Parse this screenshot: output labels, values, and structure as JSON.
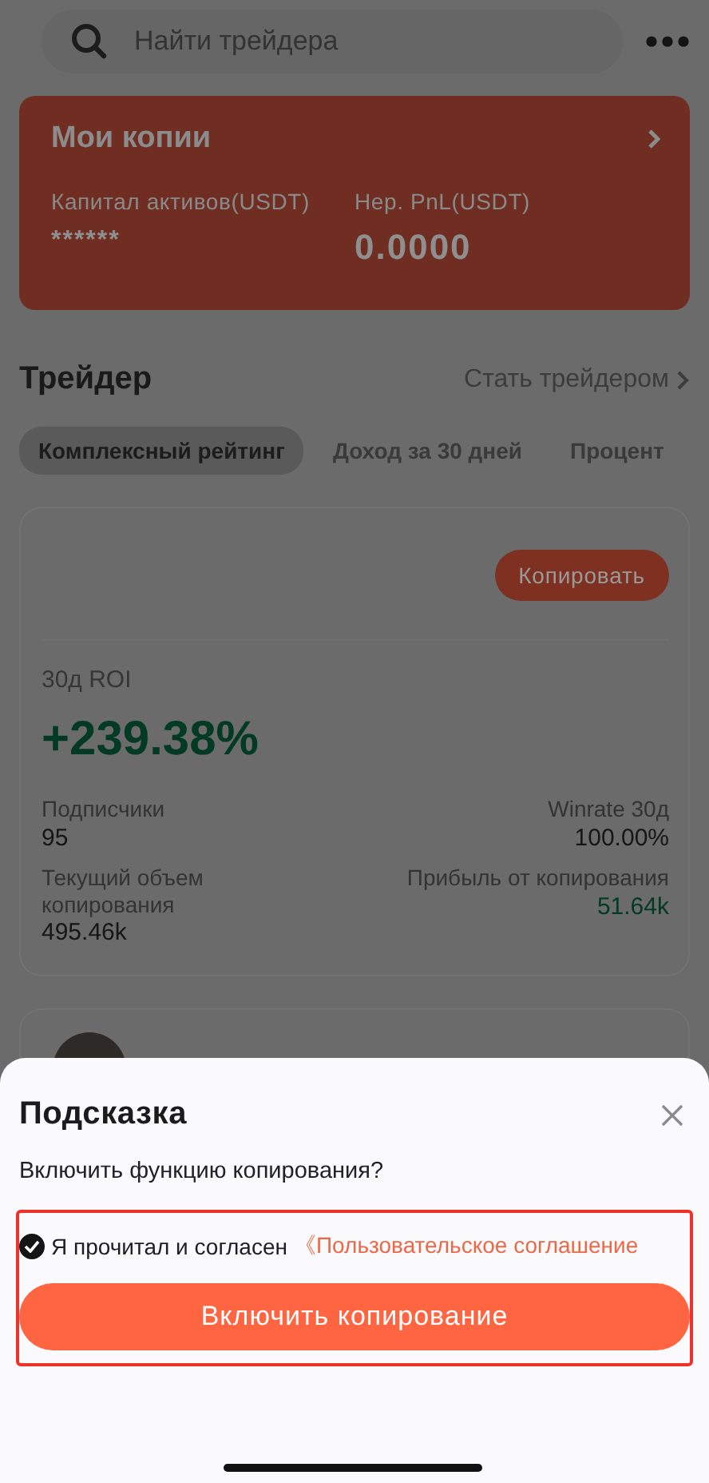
{
  "search": {
    "placeholder": "Найти трейдера"
  },
  "my_copies": {
    "title": "Мои копии",
    "stats": [
      {
        "label": "Капитал активов(USDT)",
        "value": "******",
        "kind": "masked"
      },
      {
        "label": "Нер. PnL(USDT)",
        "value": "0.0000",
        "kind": "number"
      }
    ]
  },
  "trader_section": {
    "title": "Трейдер",
    "link": "Стать трейдером"
  },
  "tabs": [
    {
      "label": "Комплексный рейтинг",
      "selected": true
    },
    {
      "label": "Доход за 30 дней",
      "selected": false
    },
    {
      "label": "Процент",
      "selected": false
    }
  ],
  "trader_card": {
    "copy_button": "Копировать",
    "roi_label": "30д ROI",
    "roi_value": "+239.38%",
    "stats": [
      {
        "label": "Подписчики",
        "value": "95",
        "positive": false
      },
      {
        "label": "Winrate 30д",
        "value": "100.00%",
        "positive": false
      },
      {
        "label": "Текущий объем копирования",
        "value": "495.46k",
        "positive": false
      },
      {
        "label": "Прибыль от копирования",
        "value": "51.64k",
        "positive": true
      }
    ]
  },
  "dialog": {
    "title": "Подсказка",
    "question": "Включить функцию копирования?",
    "agree": {
      "checked": true,
      "text": "Я прочитал и согласен",
      "link": "《Пользовательское соглашение"
    },
    "button": "Включить копирование"
  }
}
